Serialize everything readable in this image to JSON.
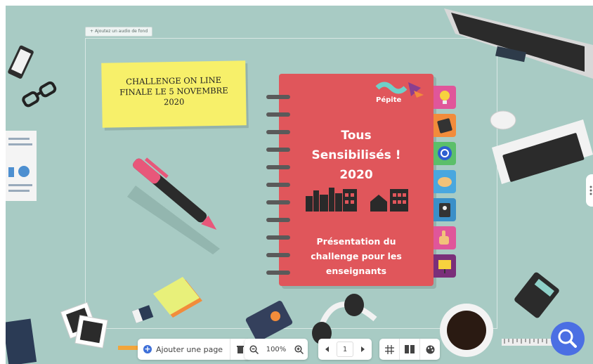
{
  "canvas": {
    "bg_audio_label": "Ajoutez un audio de fond",
    "background_color": "#a8cbc4"
  },
  "sticky_note": {
    "lines": [
      "CHALLENGE ON LINE",
      "FINALE LE 5 NOVEMBRE",
      "2020"
    ]
  },
  "notebook": {
    "logo_text": "Pépite",
    "title_lines": [
      "Tous",
      "Sensibilisés !",
      "2020"
    ],
    "subtitle_lines": [
      "Présentation du",
      "challenge pour les",
      "enseignants"
    ],
    "color": "#e0565b",
    "tabs": [
      {
        "icon": "lightbulb-icon",
        "color": "#e0569a"
      },
      {
        "icon": "tablet-icon",
        "color": "#f28c3b"
      },
      {
        "icon": "power-icon",
        "color": "#5bbf6a"
      },
      {
        "icon": "handshake-icon",
        "color": "#49a7df"
      },
      {
        "icon": "id-card-icon",
        "color": "#3a8fc8"
      },
      {
        "icon": "thumbs-up-icon",
        "color": "#e0569a"
      },
      {
        "icon": "presentation-icon",
        "color": "#7a2f7a"
      }
    ]
  },
  "toolbar": {
    "add_page_label": "Ajouter une page",
    "zoom_level": "100%",
    "page_number": "1"
  },
  "accent_color": "#4b6fe3"
}
